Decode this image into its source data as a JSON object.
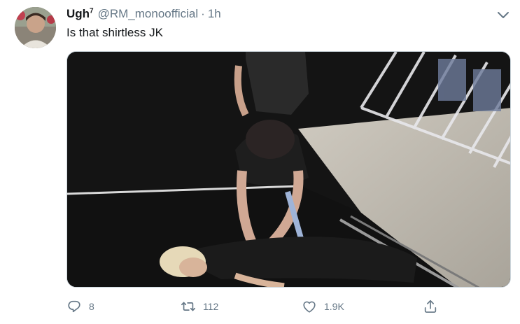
{
  "tweet": {
    "display_name": "Ugh",
    "display_name_sup": "7",
    "handle": "@RM_monoofficial",
    "separator": "·",
    "time": "1h",
    "text": "Is that shirtless JK"
  },
  "actions": {
    "reply_count": "8",
    "retweet_count": "112",
    "like_count": "1.9K"
  },
  "icons": {
    "reply": "reply-icon",
    "retweet": "retweet-icon",
    "like": "heart-icon",
    "share": "share-icon",
    "menu": "chevron-down-icon"
  },
  "colors": {
    "text_primary": "#14171a",
    "text_secondary": "#657786",
    "border": "#ccd6dd"
  }
}
